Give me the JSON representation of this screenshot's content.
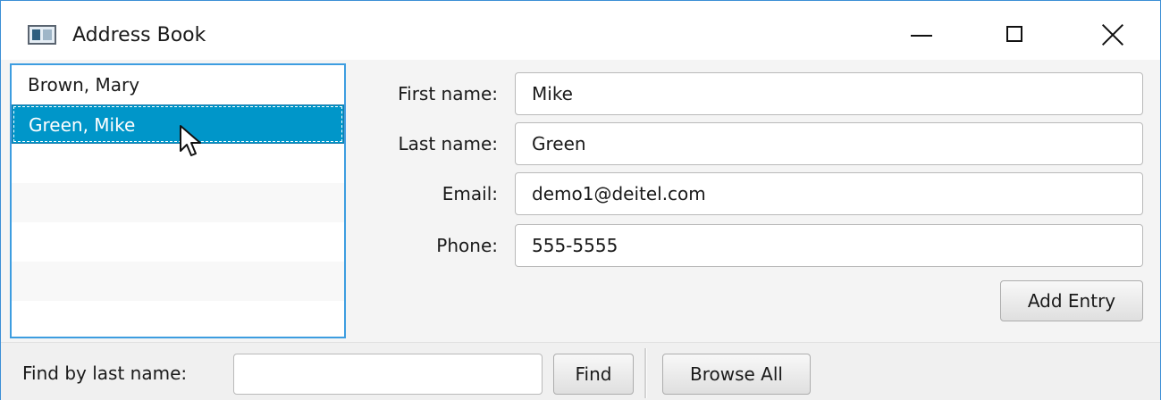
{
  "window": {
    "title": "Address Book",
    "icon": "application-window-icon",
    "controls": {
      "minimize": "minimize-icon",
      "maximize": "maximize-icon",
      "close": "close-icon"
    }
  },
  "contacts": {
    "items": [
      {
        "label": "Brown, Mary",
        "selected": false
      },
      {
        "label": "Green, Mike",
        "selected": true
      }
    ]
  },
  "form": {
    "first_name": {
      "label": "First name:",
      "value": "Mike"
    },
    "last_name": {
      "label": "Last name:",
      "value": "Green"
    },
    "email": {
      "label": "Email:",
      "value": "demo1@deitel.com"
    },
    "phone": {
      "label": "Phone:",
      "value": "555-5555"
    },
    "add_entry_label": "Add Entry"
  },
  "toolbar": {
    "find_label": "Find by last name:",
    "find_value": "",
    "find_button_label": "Find",
    "browse_all_label": "Browse All"
  },
  "colors": {
    "selection": "#0096c9",
    "focus_border": "#3d9de0",
    "window_border": "#3c8fd6"
  }
}
